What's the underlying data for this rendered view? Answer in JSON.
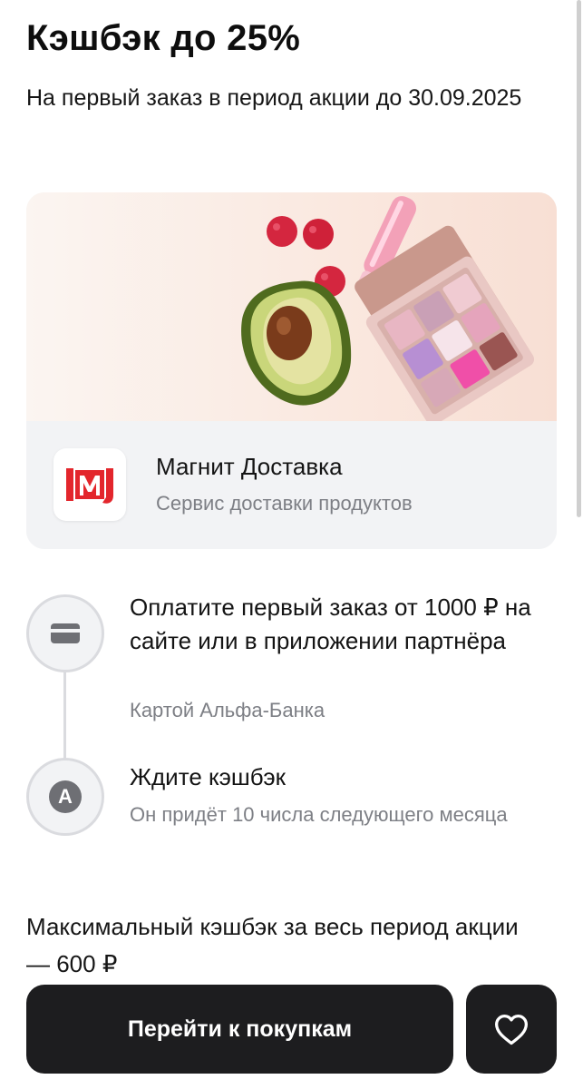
{
  "header": {
    "title": "Кэшбэк до 25%",
    "subtitle": "На первый заказ в период акции до 30.09.2025"
  },
  "partner": {
    "name": "Магнит Доставка",
    "description": "Сервис доставки продуктов",
    "logo_text": "М",
    "brand_color": "#e3262c"
  },
  "steps": [
    {
      "icon": "card-icon",
      "title": "Оплатите первый заказ от 1000 ₽ на сайте или в приложении партнёра",
      "note": "Картой Альфа-Банка"
    },
    {
      "icon": "alfa-bank-icon",
      "icon_letter": "А",
      "title": "Ждите кэшбэк",
      "note": "Он придёт 10 числа следующего месяца"
    }
  ],
  "max_cashback": "Максимальный кэшбэк за весь период акции — 600 ₽",
  "actions": {
    "primary_label": "Перейти к покупкам",
    "favorite_icon": "heart-icon"
  },
  "colors": {
    "button_bg": "#1d1d1f",
    "muted_text": "#7d7f85",
    "card_bg": "#f2f3f5"
  }
}
